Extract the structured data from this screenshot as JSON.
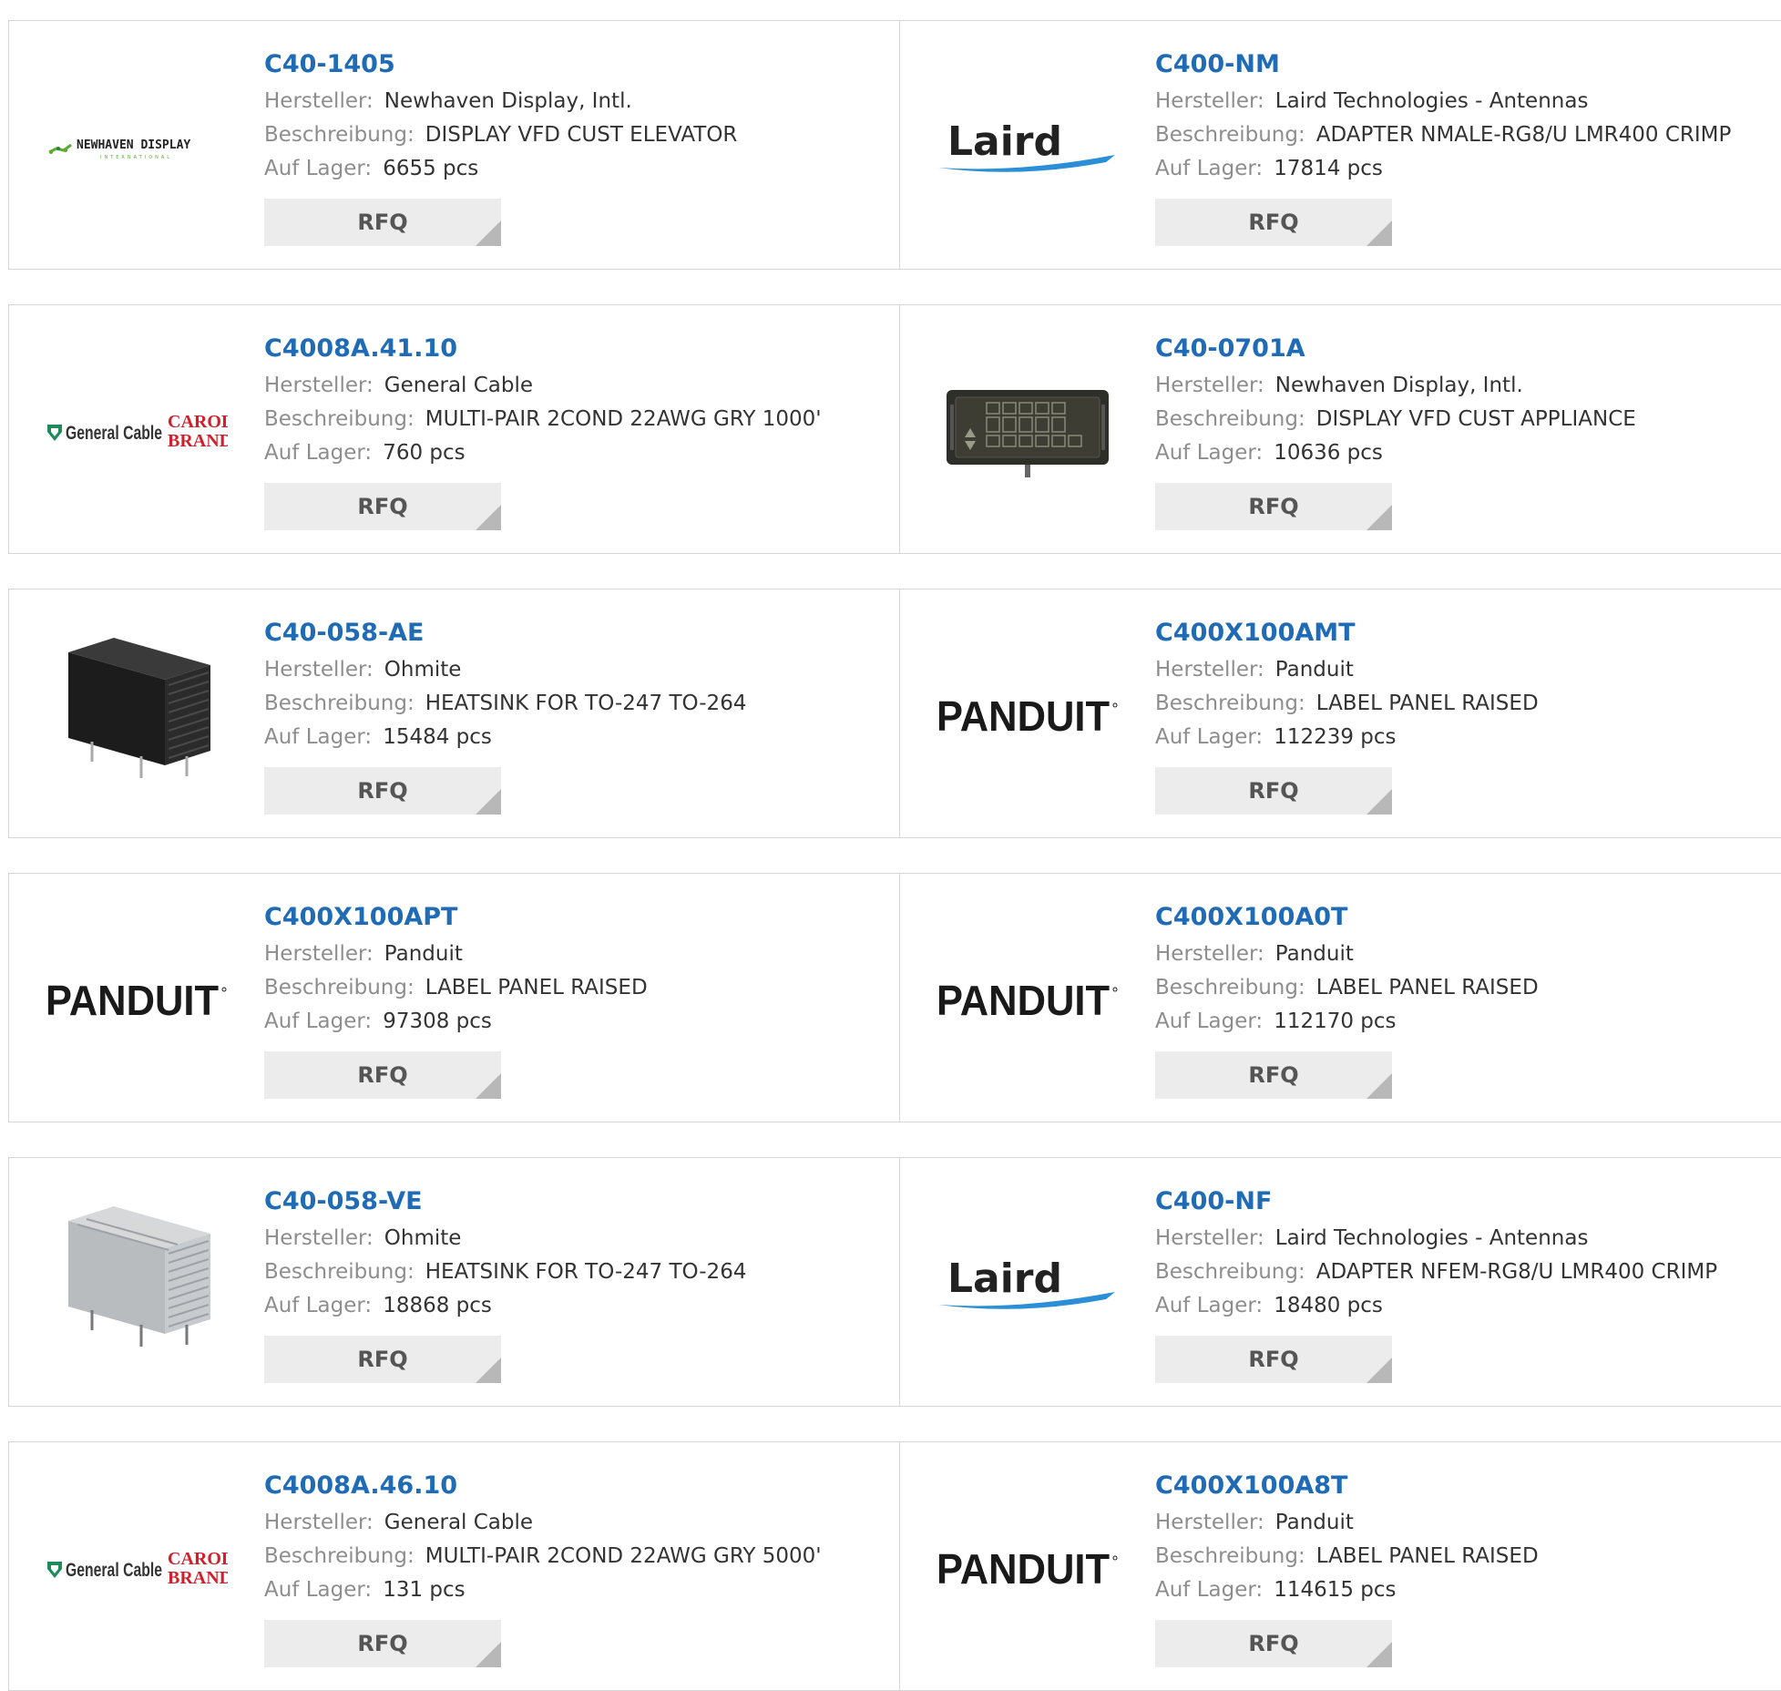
{
  "labels": {
    "manufacturer": "Hersteller:",
    "description": "Beschreibung:",
    "stock": "Auf Lager:",
    "rfq": "RFQ"
  },
  "logos": {
    "newhaven": {
      "name": "NEWHAVEN DISPLAY",
      "sub": "INTERNATIONAL"
    },
    "laird": {
      "name": "Laird"
    },
    "generalcable": {
      "name": "General Cable",
      "carol": "CAROL",
      "brand": "BRAND"
    },
    "panduit": {
      "name": "PANDUIT"
    }
  },
  "products": [
    {
      "pn": "C40-1405",
      "manufacturer": "Newhaven Display, Intl.",
      "description": "DISPLAY VFD CUST ELEVATOR",
      "stock": "6655 pcs",
      "image": "newhaven-logo"
    },
    {
      "pn": "C400-NM",
      "manufacturer": "Laird Technologies - Antennas",
      "description": "ADAPTER NMALE-RG8/U LMR400 CRIMP",
      "stock": "17814 pcs",
      "image": "laird-logo"
    },
    {
      "pn": "C4008A.41.10",
      "manufacturer": "General Cable",
      "description": "MULTI-PAIR 2COND 22AWG GRY 1000'",
      "stock": "760 pcs",
      "image": "general-cable-logo"
    },
    {
      "pn": "C40-0701A",
      "manufacturer": "Newhaven Display, Intl.",
      "description": "DISPLAY VFD CUST APPLIANCE",
      "stock": "10636 pcs",
      "image": "vfd-display-photo"
    },
    {
      "pn": "C40-058-AE",
      "manufacturer": "Ohmite",
      "description": "HEATSINK FOR TO-247 TO-264",
      "stock": "15484 pcs",
      "image": "heatsink-black-photo"
    },
    {
      "pn": "C400X100AMT",
      "manufacturer": "Panduit",
      "description": "LABEL PANEL RAISED",
      "stock": "112239 pcs",
      "image": "panduit-logo"
    },
    {
      "pn": "C400X100APT",
      "manufacturer": "Panduit",
      "description": "LABEL PANEL RAISED",
      "stock": "97308 pcs",
      "image": "panduit-logo"
    },
    {
      "pn": "C400X100A0T",
      "manufacturer": "Panduit",
      "description": "LABEL PANEL RAISED",
      "stock": "112170 pcs",
      "image": "panduit-logo"
    },
    {
      "pn": "C40-058-VE",
      "manufacturer": "Ohmite",
      "description": "HEATSINK FOR TO-247 TO-264",
      "stock": "18868 pcs",
      "image": "heatsink-silver-photo"
    },
    {
      "pn": "C400-NF",
      "manufacturer": "Laird Technologies - Antennas",
      "description": "ADAPTER NFEM-RG8/U LMR400 CRIMP",
      "stock": "18480 pcs",
      "image": "laird-logo"
    },
    {
      "pn": "C4008A.46.10",
      "manufacturer": "General Cable",
      "description": "MULTI-PAIR 2COND 22AWG GRY 5000'",
      "stock": "131 pcs",
      "image": "general-cable-logo"
    },
    {
      "pn": "C400X100A8T",
      "manufacturer": "Panduit",
      "description": "LABEL PANEL RAISED",
      "stock": "114615 pcs",
      "image": "panduit-logo"
    }
  ],
  "colors": {
    "part_number": "#1f6bb5",
    "label": "#8d8d8d",
    "value": "#333333",
    "border": "#d6d6d6",
    "rfq_bg": "#ececec",
    "rfq_corner": "#b8b8b8",
    "panduit": "#1a1a1a",
    "laird_text": "#222222",
    "laird_swoosh": "#2a8fd6",
    "general_cable_green": "#1f8a5c",
    "carol_red": "#d11f2c"
  }
}
